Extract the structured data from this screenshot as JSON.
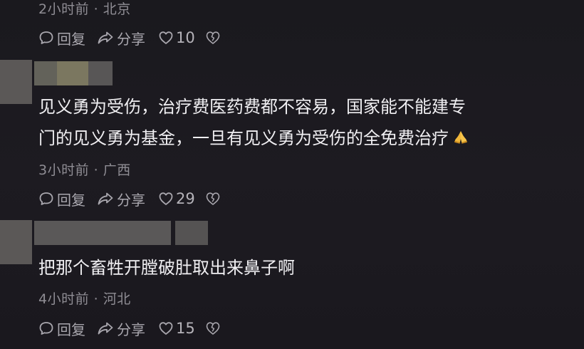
{
  "comments": [
    {
      "id": "c1",
      "meta": "2小时前 · 北京",
      "actions": {
        "reply": "回复",
        "share": "分享",
        "likes": "10"
      }
    },
    {
      "id": "c2",
      "text_line1": "见义勇为受伤，治疗费医药费都不容易，国家能不能建专",
      "text_line2": "门的见义勇为基金，一旦有见义勇为受伤的全免费治疗",
      "emoji": "praying-hands-emoji",
      "meta": "3小时前 · 广西",
      "actions": {
        "reply": "回复",
        "share": "分享",
        "likes": "29"
      }
    },
    {
      "id": "c3",
      "text_line1": "把那个畜牲开膛破肚取出来鼻子啊",
      "meta": "4小时前 · 河北",
      "actions": {
        "reply": "回复",
        "share": "分享",
        "likes": "15"
      }
    }
  ],
  "icons": {
    "reply": "comment-bubble-icon",
    "share": "share-arrow-icon",
    "like": "heart-icon",
    "dislike": "broken-heart-icon"
  },
  "colors": {
    "background": "#1b1a20",
    "text": "#f0eff2",
    "meta": "#8f8d94",
    "action": "#a9a7ae",
    "redaction": "#5c5a5a"
  }
}
